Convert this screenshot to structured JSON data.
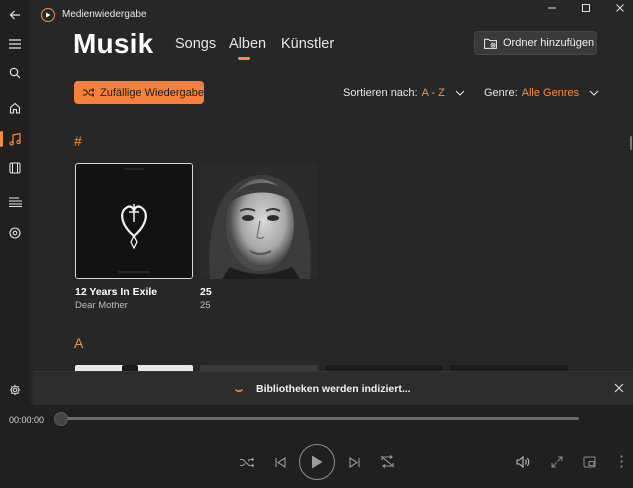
{
  "window": {
    "title": "Medienwiedergabe",
    "accent": "#ff8c3c"
  },
  "nav": {
    "items": [
      {
        "name": "back",
        "icon": "back-arrow-icon"
      },
      {
        "name": "menu",
        "icon": "hamburger-icon"
      },
      {
        "name": "search",
        "icon": "search-icon"
      },
      {
        "name": "home",
        "icon": "home-icon"
      },
      {
        "name": "music",
        "icon": "music-note-icon",
        "active": true
      },
      {
        "name": "videos",
        "icon": "film-icon"
      },
      {
        "name": "playlists",
        "icon": "list-icon"
      },
      {
        "name": "disc",
        "icon": "disc-icon"
      },
      {
        "name": "settings",
        "icon": "gear-icon"
      }
    ]
  },
  "header": {
    "title": "Musik",
    "tabs": [
      {
        "label": "Songs",
        "active": false
      },
      {
        "label": "Alben",
        "active": true
      },
      {
        "label": "Künstler",
        "active": false
      }
    ],
    "add_folder_label": "Ordner hinzufügen"
  },
  "toolbar": {
    "shuffle_label": "Zufällige Wiedergabe",
    "sort_label": "Sortieren nach:",
    "sort_value": "A - Z",
    "genre_label": "Genre:",
    "genre_value": "Alle Genres"
  },
  "sections": [
    {
      "letter": "#",
      "albums": [
        {
          "title": "12 Years In Exile",
          "artist": "Dear Mother"
        },
        {
          "title": "25",
          "artist": "25"
        }
      ]
    },
    {
      "letter": "A",
      "albums": []
    }
  ],
  "banner": {
    "text": "Bibliotheken werden indiziert..."
  },
  "player": {
    "time_current": "00:00:00",
    "progress": 0
  }
}
